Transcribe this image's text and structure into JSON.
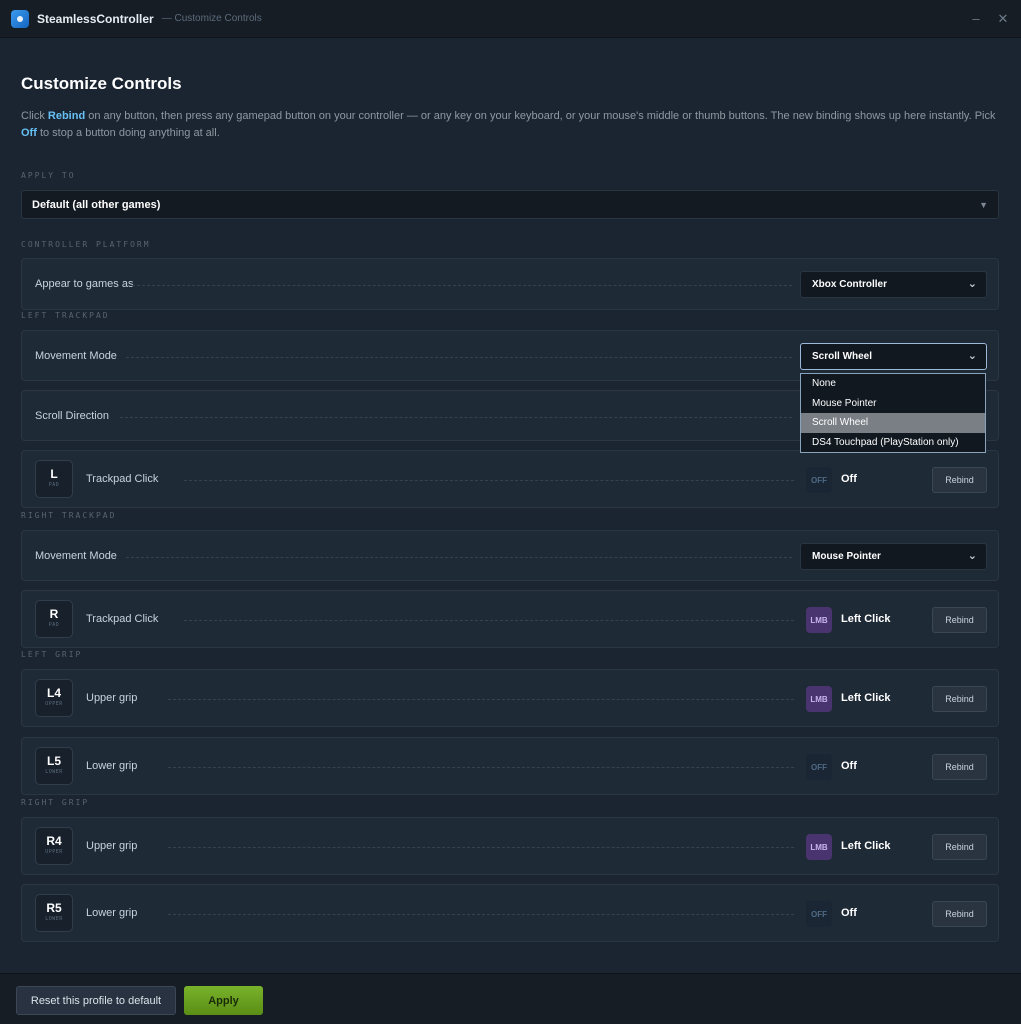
{
  "window": {
    "app_name": "SteamlessController",
    "subtitle": "— Customize Controls",
    "minimize": "–",
    "close": "✕"
  },
  "page": {
    "title": "Customize Controls",
    "intro_1": "Click ",
    "intro_rebind": "Rebind",
    "intro_2": " on any button, then press any gamepad button on your controller — or any key on your keyboard, or your mouse's middle or thumb buttons. The new binding shows up here instantly. Pick ",
    "intro_off": "Off",
    "intro_3": " to stop a button doing anything at all."
  },
  "apply_to": {
    "label": "APPLY TO",
    "value": "Default (all other games)"
  },
  "platform": {
    "label": "CONTROLLER PLATFORM",
    "row_label": "Appear to games as",
    "value": "Xbox Controller"
  },
  "left_trackpad": {
    "label": "LEFT TRACKPAD",
    "movement_label": "Movement Mode",
    "movement_value": "Scroll Wheel",
    "scroll_label": "Scroll Direction",
    "click": {
      "badge": "L",
      "badge_sub": "PAD",
      "name": "Trackpad Click",
      "chip": "OFF",
      "binding": "Off",
      "rebind": "Rebind"
    }
  },
  "movement_dropdown": {
    "options": [
      "None",
      "Mouse Pointer",
      "Scroll Wheel",
      "DS4 Touchpad (PlayStation only)"
    ],
    "selected": "Scroll Wheel"
  },
  "right_trackpad": {
    "label": "RIGHT TRACKPAD",
    "movement_label": "Movement Mode",
    "movement_value": "Mouse Pointer",
    "click": {
      "badge": "R",
      "badge_sub": "PAD",
      "name": "Trackpad Click",
      "chip": "LMB",
      "binding": "Left Click",
      "rebind": "Rebind"
    }
  },
  "left_grip": {
    "label": "LEFT GRIP",
    "upper": {
      "badge": "L4",
      "badge_sub": "UPPER",
      "name": "Upper grip",
      "chip": "LMB",
      "binding": "Left Click",
      "rebind": "Rebind"
    },
    "lower": {
      "badge": "L5",
      "badge_sub": "LOWER",
      "name": "Lower grip",
      "chip": "OFF",
      "binding": "Off",
      "rebind": "Rebind"
    }
  },
  "right_grip": {
    "label": "RIGHT GRIP",
    "upper": {
      "badge": "R4",
      "badge_sub": "UPPER",
      "name": "Upper grip",
      "chip": "LMB",
      "binding": "Left Click",
      "rebind": "Rebind"
    },
    "lower": {
      "badge": "R5",
      "badge_sub": "LOWER",
      "name": "Lower grip",
      "chip": "OFF",
      "binding": "Off",
      "rebind": "Rebind"
    }
  },
  "footer": {
    "reset": "Reset this profile to default",
    "apply": "Apply"
  },
  "colors": {
    "accent": "#66c0f4",
    "apply_green": "#6ea322",
    "lmb_chip": "#4a3470"
  },
  "icons": {
    "app": "app-logo-icon",
    "caret": "caret-down-icon",
    "chevron": "chevron-down-icon"
  }
}
